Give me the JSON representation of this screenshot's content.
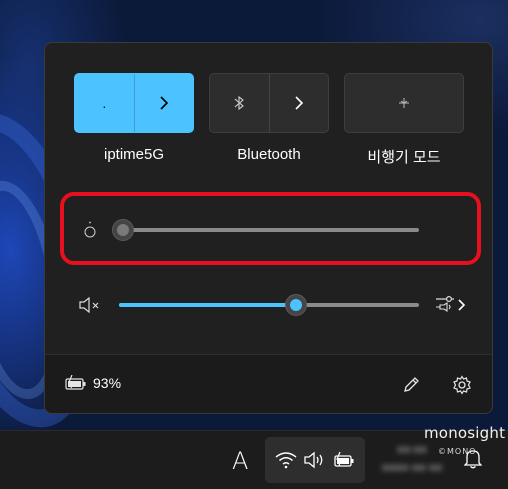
{
  "quick_settings": {
    "tiles": [
      {
        "label": "iptime5G",
        "icon": "wifi-icon",
        "active": true,
        "has_expand": true
      },
      {
        "label": "Bluetooth",
        "icon": "bluetooth-icon",
        "active": false,
        "has_expand": true
      },
      {
        "label": "비행기 모드",
        "icon": "airplane-icon",
        "active": false,
        "has_expand": false
      }
    ],
    "brightness": {
      "icon": "brightness-icon",
      "level_percent": 0
    },
    "volume": {
      "icon": "speaker-muted-icon",
      "level_percent": 59,
      "mixer_icon": "volume-mixer-icon"
    },
    "footer": {
      "battery_icon": "battery-charging-icon",
      "battery_percent": "93%",
      "edit_icon": "pencil-icon",
      "settings_icon": "gear-icon"
    },
    "highlight_color": "#e8101f",
    "accent_color": "#4cc2ff"
  },
  "taskbar": {
    "ime_indicator": "A",
    "tray_icons": [
      "wifi-icon",
      "speaker-icon",
      "battery-charging-icon"
    ],
    "notification_icon": "bell-icon"
  },
  "watermark": {
    "text": "monosight",
    "sub": "©MONO"
  }
}
